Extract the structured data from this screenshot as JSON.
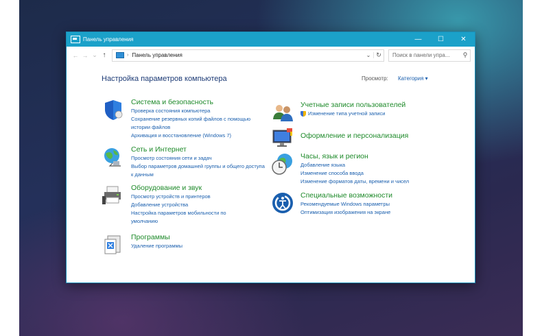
{
  "window": {
    "title": "Панель управления",
    "buttons": {
      "minimize": "—",
      "maximize": "☐",
      "close": "✕"
    }
  },
  "nav": {
    "back": "←",
    "forward": "→",
    "recent": "⌄",
    "up": "↑"
  },
  "address": {
    "path": "Панель управления",
    "separator": "›",
    "dropdown": "⌄",
    "refresh": "↻"
  },
  "search": {
    "placeholder": "Поиск в панели упра...",
    "icon": "search-icon"
  },
  "page": {
    "heading": "Настройка параметров компьютера"
  },
  "view": {
    "label": "Просмотр:",
    "value": "Категория ▾"
  },
  "categories": [
    {
      "title": "Система и безопасность",
      "icon": "shield-icon",
      "links": [
        "Проверка состояния компьютера",
        "Сохранение резервных копий файлов с помощью истории файлов",
        "Архивация и восстановление (Windows 7)"
      ]
    },
    {
      "title": "Сеть и Интернет",
      "icon": "globe-network-icon",
      "links": [
        "Просмотр состояния сети и задач",
        "Выбор параметров домашней группы и общего доступа к данным"
      ]
    },
    {
      "title": "Оборудование и звук",
      "icon": "printer-icon",
      "links": [
        "Просмотр устройств и принтеров",
        "Добавление устройства",
        "Настройка параметров мобильности по умолчанию"
      ]
    },
    {
      "title": "Программы",
      "icon": "programs-icon",
      "links": [
        "Удаление программы"
      ]
    },
    {
      "title": "Учетные записи пользователей",
      "icon": "users-icon",
      "links": [
        "Изменение типа учетной записи"
      ]
    },
    {
      "title": "Оформление и персонализация",
      "icon": "monitor-icon",
      "links": []
    },
    {
      "title": "Часы, язык и регион",
      "icon": "clock-globe-icon",
      "links": [
        "Добавление языка",
        "Изменение способа ввода",
        "Изменение форматов даты, времени и чисел"
      ]
    },
    {
      "title": "Специальные возможности",
      "icon": "accessibility-icon",
      "links": [
        "Рекомендуемые Windows параметры",
        "Оптимизация изображения на экране"
      ]
    }
  ]
}
